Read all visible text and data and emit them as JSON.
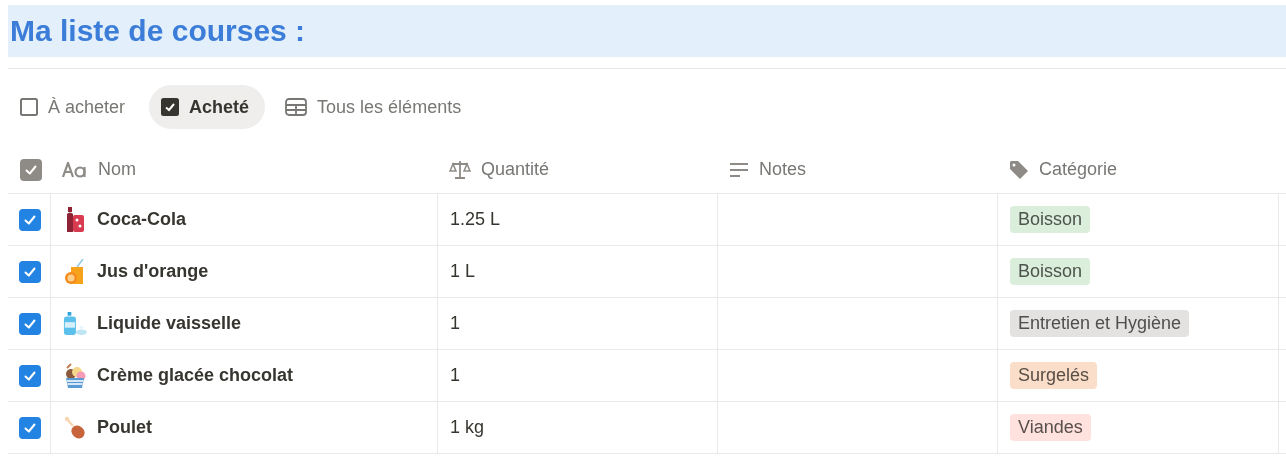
{
  "title": "Ma liste de courses :",
  "tabs": [
    {
      "label": "À acheter",
      "selected": false
    },
    {
      "label": "Acheté",
      "selected": true
    },
    {
      "label": "Tous les éléments",
      "selected": false
    }
  ],
  "table": {
    "columns": [
      "Nom",
      "Quantité",
      "Notes",
      "Catégorie"
    ],
    "header_checked": true,
    "rows": [
      {
        "checked": true,
        "name": "Coca-Cola",
        "quantity": "1.25 L",
        "category": {
          "label": "Boisson",
          "color": "#dbeddb"
        }
      },
      {
        "checked": true,
        "name": "Jus d'orange",
        "quantity": "1 L",
        "category": {
          "label": "Boisson",
          "color": "#dbeddb"
        }
      },
      {
        "checked": true,
        "name": "Liquide vaisselle",
        "quantity": "1",
        "category": {
          "label": "Entretien et Hygiène",
          "color": "#e3e2e0"
        }
      },
      {
        "checked": true,
        "name": "Crème glacée chocolat",
        "quantity": "1",
        "category": {
          "label": "Surgelés",
          "color": "#fadec9"
        }
      },
      {
        "checked": true,
        "name": "Poulet",
        "quantity": "1 kg",
        "category": {
          "label": "Viandes",
          "color": "#ffe2dd"
        }
      }
    ]
  }
}
